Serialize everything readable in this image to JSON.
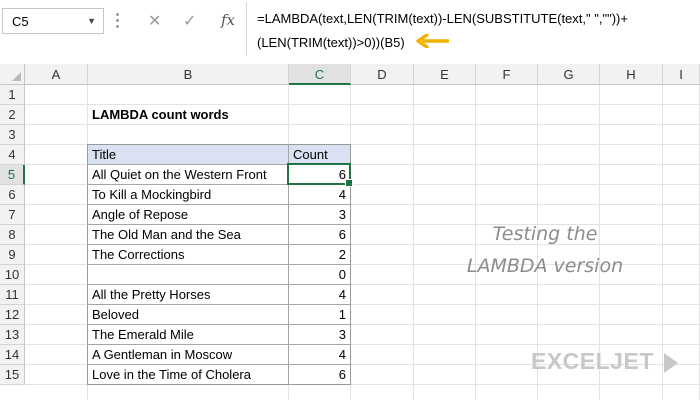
{
  "name_box": {
    "value": "C5"
  },
  "formula_bar": {
    "cancel_icon": "x-icon",
    "enter_icon": "check-icon",
    "function_icon": "fx-icon",
    "fx_label": "fx",
    "line1": "=LAMBDA(text,LEN(TRIM(text))-LEN(SUBSTITUTE(text,\" \",\"\"))+",
    "line2": "(LEN(TRIM(text))>0))(B5)",
    "arrow_color": "#f2b200"
  },
  "columns": [
    "A",
    "B",
    "C",
    "D",
    "E",
    "F",
    "G",
    "H",
    "I"
  ],
  "rows": [
    "1",
    "2",
    "3",
    "4",
    "5",
    "6",
    "7",
    "8",
    "9",
    "10",
    "11",
    "12",
    "13",
    "14",
    "15"
  ],
  "selected_cell": {
    "column": "C",
    "row": "5"
  },
  "sheet": {
    "title": "LAMBDA count words",
    "table_header": {
      "title": "Title",
      "count": "Count"
    },
    "table_rows": [
      {
        "title": "All Quiet on the Western Front",
        "count": "6"
      },
      {
        "title": "To Kill a Mockingbird",
        "count": "4"
      },
      {
        "title": "Angle of Repose",
        "count": "3"
      },
      {
        "title": "The Old Man and the Sea",
        "count": "6"
      },
      {
        "title": "The Corrections",
        "count": "2"
      },
      {
        "title": "",
        "count": "0"
      },
      {
        "title": "All the Pretty Horses",
        "count": "4"
      },
      {
        "title": "Beloved",
        "count": "1"
      },
      {
        "title": "The Emerald Mile",
        "count": "3"
      },
      {
        "title": "A Gentleman in Moscow",
        "count": "4"
      },
      {
        "title": "Love in the Time of Cholera",
        "count": "6"
      }
    ],
    "note_line1": "Testing the",
    "note_line2": "LAMBDA version"
  },
  "logo": {
    "text": "EXCELJET"
  },
  "colors": {
    "accent": "#217346",
    "table_header_fill": "#d9e1f2",
    "note_text": "#8c8c8c"
  }
}
